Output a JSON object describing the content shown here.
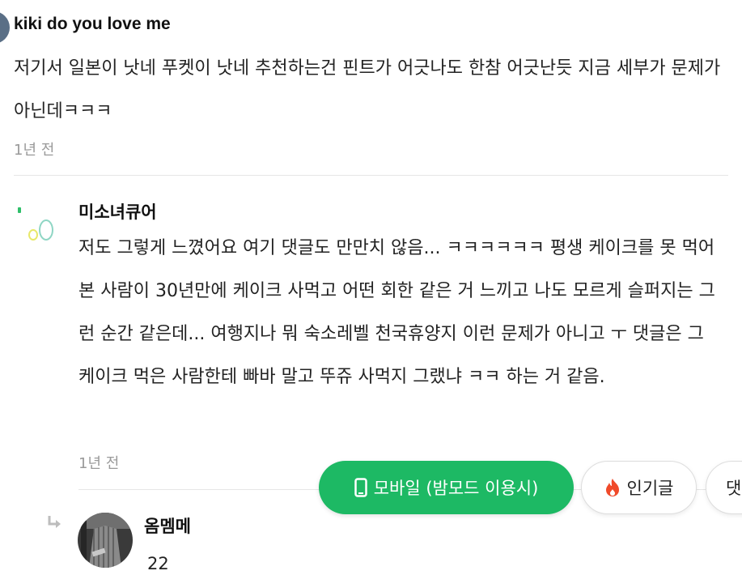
{
  "comments": [
    {
      "author": "kiki do you love me",
      "text": "저기서 일본이 낫네 푸켓이 낫네 추천하는건 핀트가 어긋나도 한참 어긋난듯 지금 세부가 문제가 아닌데ㅋㅋㅋ",
      "time": "1년 전"
    },
    {
      "author": "미소녀큐어",
      "text": "저도 그렇게 느꼈어요 여기 댓글도 만만치 않음... ㅋㅋㅋㅋㅋㅋ 평생 케이크를 못 먹어본 사람이 30년만에 케이크 사먹고 어떤 회한 같은 거 느끼고 나도 모르게 슬퍼지는 그런 순간 같은데... 여행지나 뭐 숙소레벨 천국휴양지 이런 문제가 아니고 ㅜ 댓글은 그 케이크 먹은 사람한테 빠바 말고 뚜쥬 사먹지 그랬냐 ㅋㅋ 하는 거 같음.",
      "time": "1년 전"
    },
    {
      "author": "옴멤메",
      "text": "22"
    }
  ],
  "floating_buttons": {
    "mobile": "모바일 (밤모드 이용시)",
    "popular": "인기글",
    "comment": "댓글"
  },
  "colors": {
    "mobile_button_bg": "#1db964",
    "popular_icon": "#f04a2a"
  },
  "icons": {
    "mobile": "phone-icon",
    "popular": "fire-icon",
    "reply": "reply-arrow-icon"
  }
}
